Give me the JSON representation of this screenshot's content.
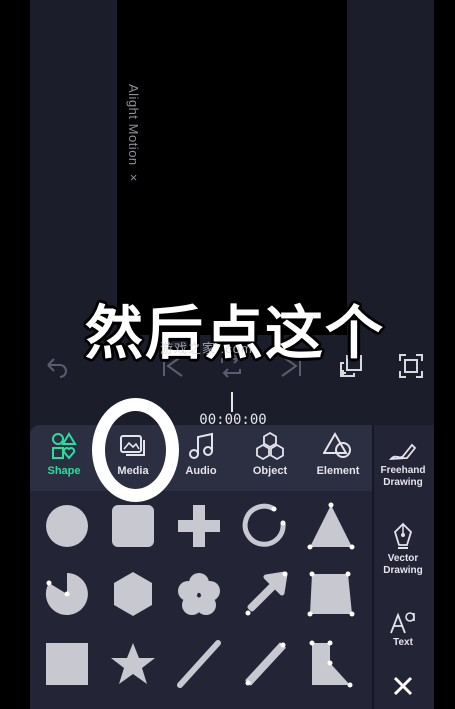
{
  "canvas": {
    "watermark": "Alight Motion ×"
  },
  "caption": {
    "text": "然后点这个"
  },
  "site_watermark": {
    "text": "游戏之家 .com"
  },
  "timeline": {
    "timecode": "00:00:00"
  },
  "toolbar": {
    "items": [
      {
        "icon": "undo-icon"
      },
      {
        "icon": "skip-to-start-icon"
      },
      {
        "icon": "loop-icon"
      },
      {
        "icon": "skip-to-end-icon"
      },
      {
        "icon": "duplicate-icon"
      },
      {
        "icon": "fit-screen-icon"
      }
    ]
  },
  "add_panel": {
    "tabs": [
      {
        "label": "Shape",
        "icon": "shape-icon",
        "active": true
      },
      {
        "label": "Media",
        "icon": "media-icon",
        "active": false
      },
      {
        "label": "Audio",
        "icon": "music-note-icon",
        "active": false
      },
      {
        "label": "Object",
        "icon": "object-icon",
        "active": false
      },
      {
        "label": "Element",
        "icon": "element-icon",
        "active": false
      }
    ],
    "side": {
      "freehand": "Freehand Drawing",
      "vector": "Vector Drawing",
      "text": "Text",
      "close_icon": "close-icon"
    },
    "shapes": [
      "circle",
      "rounded-square",
      "plus",
      "arc",
      "triangle",
      "pie",
      "hexagon",
      "flower",
      "arrow",
      "trapezoid",
      "square",
      "star",
      "line",
      "thick-line",
      "polygon"
    ]
  },
  "colors": {
    "accent": "#27e0a0",
    "panel": "#232536",
    "shape_fill": "#c8c8d0"
  }
}
